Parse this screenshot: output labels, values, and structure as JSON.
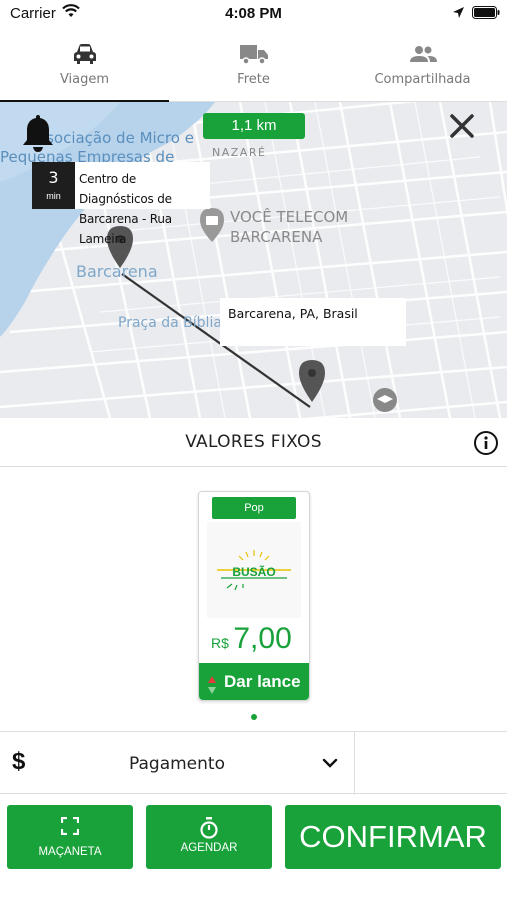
{
  "status_bar": {
    "carrier": "Carrier",
    "time": "4:08 PM"
  },
  "tabs": [
    {
      "label": "Viagem",
      "icon": "car-icon",
      "active": true
    },
    {
      "label": "Frete",
      "icon": "truck-icon",
      "active": false
    },
    {
      "label": "Compartilhada",
      "icon": "people-icon",
      "active": false
    }
  ],
  "map": {
    "distance": "1,1 km",
    "eta_value": "3",
    "eta_unit": "min",
    "origin_line1": "Centro de Diagnósticos de",
    "origin_line2": "Barcarena - Rua Lameira",
    "destination": "Barcarena, PA, Brasil",
    "labels": {
      "assoc_line1": "Associação de Micro e",
      "assoc_line2": "Pequenas Empresas de",
      "nazare": "NAZARÉ",
      "telecom_line1": "VOCÊ TELECOM",
      "telecom_line2": "BARCARENA",
      "city": "Barcarena",
      "praca": "Praça da Bíblia"
    },
    "route_color": "#333333",
    "water_color": "#b7d3ec"
  },
  "section": {
    "title": "VALORES FIXOS"
  },
  "card": {
    "badge": "Pop",
    "logo_text": "BUSÃO",
    "currency": "R$",
    "price": "7,00",
    "bid_label": "Dar lance"
  },
  "payment": {
    "symbol": "$",
    "label": "Pagamento"
  },
  "buttons": {
    "door": "MAÇANETA",
    "schedule": "AGENDAR",
    "confirm": "CONFIRMAR"
  },
  "colors": {
    "primary": "#19a13a",
    "dark": "#1e1e1e"
  }
}
